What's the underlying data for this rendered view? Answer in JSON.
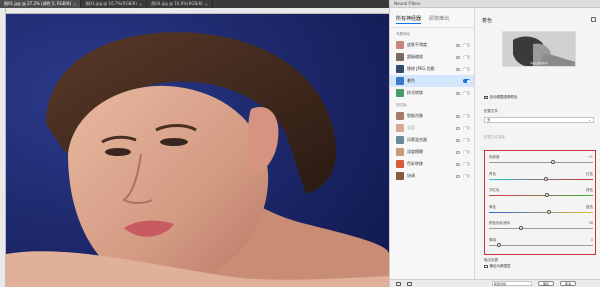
{
  "tabs": [
    {
      "label": "图01.jpg @ 27.2% (调色 5, RGB/8)",
      "active": true
    },
    {
      "label": "图03.jpg @ 16.7%(RGB/8)",
      "active": false
    },
    {
      "label": "图04.jpg @ 16.6%(RGB/8)",
      "active": false
    }
  ],
  "panel": {
    "title": "Neural Filters",
    "tabs": [
      "所有神经器",
      "即将推出"
    ],
    "sections": [
      {
        "label": "专题神经",
        "items": [
          {
            "name": "皮肤平滑度",
            "thumb": "#c8857a",
            "state": "off"
          },
          {
            "name": "超级缩放",
            "thumb": "#7a6a62",
            "state": "off"
          },
          {
            "name": "移除 JPEG 伪影",
            "thumb": "#2f4a6a",
            "state": "off"
          },
          {
            "name": "着色",
            "thumb": "#3a78c8",
            "state": "on",
            "selected": true
          },
          {
            "name": "样式转换",
            "thumb": "#4a9a6a",
            "state": "off"
          }
        ]
      },
      {
        "label": "测试版",
        "items": [
          {
            "name": "智能肖像",
            "thumb": "#a87868",
            "state": "off"
          },
          {
            "name": "妆容",
            "thumb": "#d8a898",
            "state": "off",
            "dim": true
          },
          {
            "name": "风景混合器",
            "thumb": "#6a8a9a",
            "state": "off"
          },
          {
            "name": "深度模糊",
            "thumb": "#c89a78",
            "state": "off"
          },
          {
            "name": "色彩转移",
            "thumb": "#d85a3a",
            "state": "off"
          },
          {
            "name": "协调",
            "thumb": "#8a5a3a",
            "state": "off"
          }
        ]
      }
    ],
    "settings": {
      "title": "着色",
      "ref_caption": "单击以选择参考",
      "auto_color_label": "自动调整图像颜色",
      "auto_color_checked": true,
      "preset_label": "配置文件",
      "preset_value": "无",
      "strength_label": "配置文件强度",
      "sliders": [
        {
          "label_left": "饱和度",
          "label_right": "+1",
          "value": 0.62,
          "gradient": "none"
        },
        {
          "label_left": "青色",
          "label_right": "红色",
          "value": 0.55,
          "gradient": "cy"
        },
        {
          "label_left": "洋红色",
          "label_right": "绿色",
          "value": 0.56,
          "gradient": "rg"
        },
        {
          "label_left": "黄色",
          "label_right": "蓝色",
          "value": 0.58,
          "gradient": "yb"
        },
        {
          "label_left": "颜色伪影消除",
          "label_right": "30",
          "value": 0.3,
          "gradient": "none"
        },
        {
          "label_left": "降噪",
          "label_right": "0",
          "value": 0.08,
          "gradient": "none"
        }
      ],
      "output_label": "输出设置",
      "output_checkbox_label": "输出为新图层",
      "output_checked": false
    },
    "bottom": {
      "output_value": "新建文档",
      "ok_label": "确定",
      "cancel_label": "取消"
    }
  },
  "icons": [
    "close-icon",
    "panel-menu-icon",
    "cloud-download-icon",
    "layers-icon",
    "mask-icon",
    "dropdown-caret-icon"
  ],
  "colors": {
    "accent": "#1473e6",
    "highlight_box": "#c8323c",
    "canvas_bg": "#1e2a6e"
  }
}
